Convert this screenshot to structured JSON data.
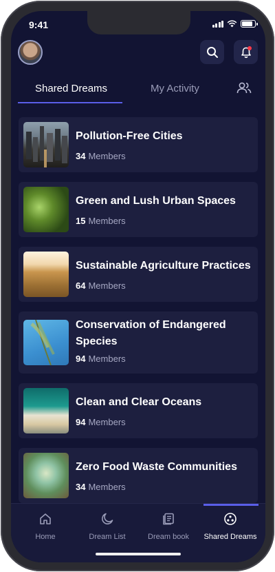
{
  "status_bar": {
    "time": "9:41"
  },
  "header": {
    "avatar_icon": "avatar",
    "search_icon": "search-icon",
    "notification_icon": "bell-icon"
  },
  "tabs": {
    "active": "Shared Dreams",
    "inactive": "My Activity",
    "people_icon": "people-icon"
  },
  "dreams": [
    {
      "title": "Pollution-Free Cities",
      "count": "34",
      "suffix": "Members"
    },
    {
      "title": "Green and Lush Urban Spaces",
      "count": "15",
      "suffix": "Members"
    },
    {
      "title": "Sustainable Agriculture Practices",
      "count": "64",
      "suffix": "Members"
    },
    {
      "title": "Conservation of Endangered Species",
      "count": "94",
      "suffix": "Members"
    },
    {
      "title": "Clean and Clear Oceans",
      "count": "94",
      "suffix": "Members"
    },
    {
      "title": "Zero Food Waste Communities",
      "count": "34",
      "suffix": "Members"
    }
  ],
  "bottom_nav": [
    {
      "label": "Home",
      "icon": "home-icon"
    },
    {
      "label": "Dream List",
      "icon": "moon-icon"
    },
    {
      "label": "Dream book",
      "icon": "book-icon"
    },
    {
      "label": "Shared Dreams",
      "icon": "shared-icon",
      "active": true
    }
  ],
  "colors": {
    "background": "#121433",
    "card": "#1d1f3f",
    "accent": "#5a5ee8"
  }
}
